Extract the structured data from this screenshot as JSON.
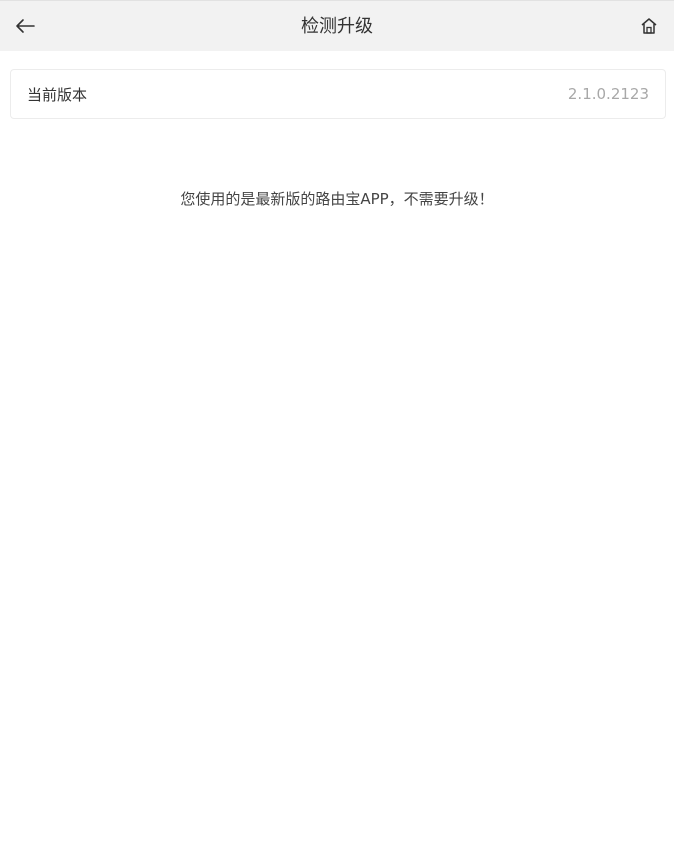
{
  "header": {
    "title": "检测升级",
    "back_icon": "arrow-left-icon",
    "home_icon": "home-icon"
  },
  "version": {
    "label": "当前版本",
    "value": "2.1.0.2123"
  },
  "message": "您使用的是最新版的路由宝APP，不需要升级！",
  "colors": {
    "header_bg": "#f2f2f2",
    "text": "#333333",
    "muted": "#a8a8a8",
    "card_border": "#ececec"
  }
}
